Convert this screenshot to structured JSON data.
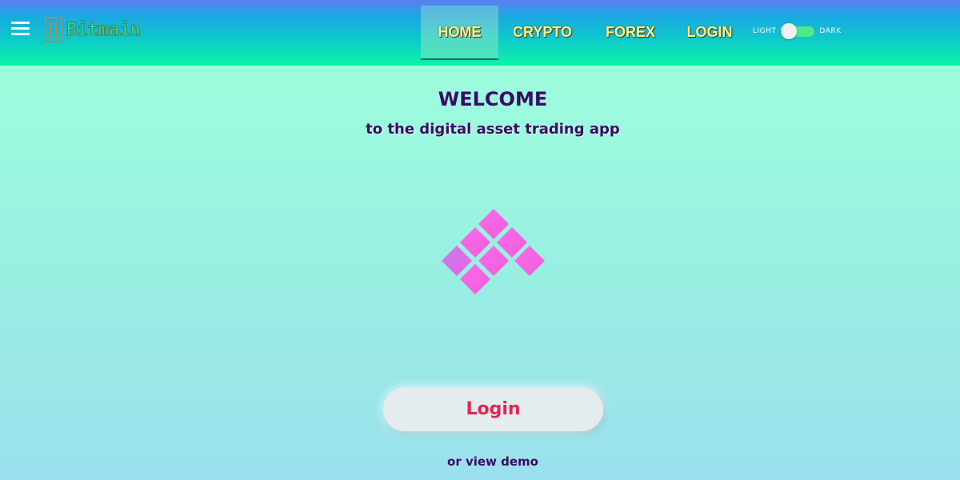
{
  "header": {
    "menu_icon": "hamburger-menu-icon",
    "brand": {
      "icon": "circuit-phone-logo-icon",
      "name": "Bitmain"
    },
    "nav": [
      {
        "label": "HOME",
        "active": true
      },
      {
        "label": "CRYPTO",
        "active": false
      },
      {
        "label": "FOREX",
        "active": false
      },
      {
        "label": "LOGIN",
        "active": false
      }
    ],
    "theme_toggle": {
      "left_label": "LIGHT",
      "right_label": "DARK",
      "state": "light"
    }
  },
  "main": {
    "title": "WELCOME",
    "subtitle": "to the digital asset trading app",
    "logo_icon": "diamond-tiles-logo-icon",
    "login_button": "Login",
    "demo_link": "or view demo"
  },
  "colors": {
    "nav_text": "#f7f47a",
    "heading": "#3b0a66",
    "login_text": "#dd2752",
    "tile_pink": "#f762e6",
    "toggle_track": "#4ee88a"
  }
}
